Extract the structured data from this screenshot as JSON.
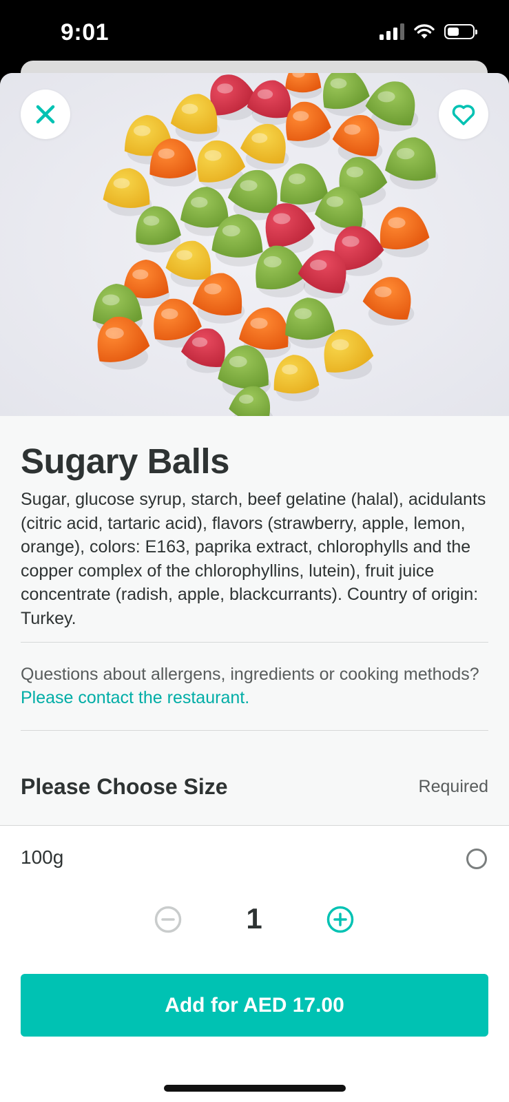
{
  "status_bar": {
    "time": "9:01"
  },
  "product": {
    "title": "Sugary Balls",
    "description": "Sugar, glucose syrup, starch, beef gelatine (halal), acidulants (citric acid, tartaric acid), flavors (strawberry, apple, lemon, orange), colors: E163, paprika extract, chlorophylls and the copper complex of the chlorophyllins, lutein), fruit juice concentrate (radish, apple, blackcurrants). Country of origin: Turkey."
  },
  "allergen_info": {
    "text": "Questions about allergens, ingredients or cooking methods?",
    "link": "Please contact the restaurant."
  },
  "size_section": {
    "title": "Please Choose Size",
    "required_label": "Required",
    "options": [
      {
        "label": "100g",
        "selected": false
      }
    ]
  },
  "footer": {
    "quantity": "1",
    "add_button": "Add for AED 17.00"
  },
  "colors": {
    "accent": "#00c2b3",
    "link": "#00ada6",
    "text": "#2e3333"
  },
  "icons": [
    "close-icon",
    "heart-icon",
    "minus-circle-icon",
    "plus-circle-icon",
    "radio-icon"
  ]
}
